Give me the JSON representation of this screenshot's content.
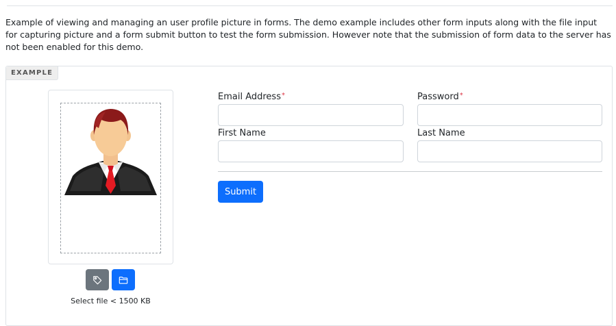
{
  "intro": {
    "text": "Example of viewing and managing an user profile picture in forms. The demo example includes other form inputs along with the file input for capturing picture and a form submit button to test the form submission. However note that the submission of form data to the server has not been enabled for this demo."
  },
  "example": {
    "tag_label": "EXAMPLE",
    "upload": {
      "tag_button_icon": "tag-icon",
      "browse_button_icon": "folder-icon",
      "note": "Select file < 1500 KB"
    },
    "form": {
      "email": {
        "label": "Email Address",
        "required_mark": "*",
        "value": ""
      },
      "password": {
        "label": "Password",
        "required_mark": "*",
        "value": ""
      },
      "first_name": {
        "label": "First Name",
        "value": ""
      },
      "last_name": {
        "label": "Last Name",
        "value": ""
      },
      "submit_label": "Submit"
    }
  },
  "colors": {
    "primary": "#0d6efd",
    "secondary": "#6c757d",
    "required": "#dc3545"
  }
}
